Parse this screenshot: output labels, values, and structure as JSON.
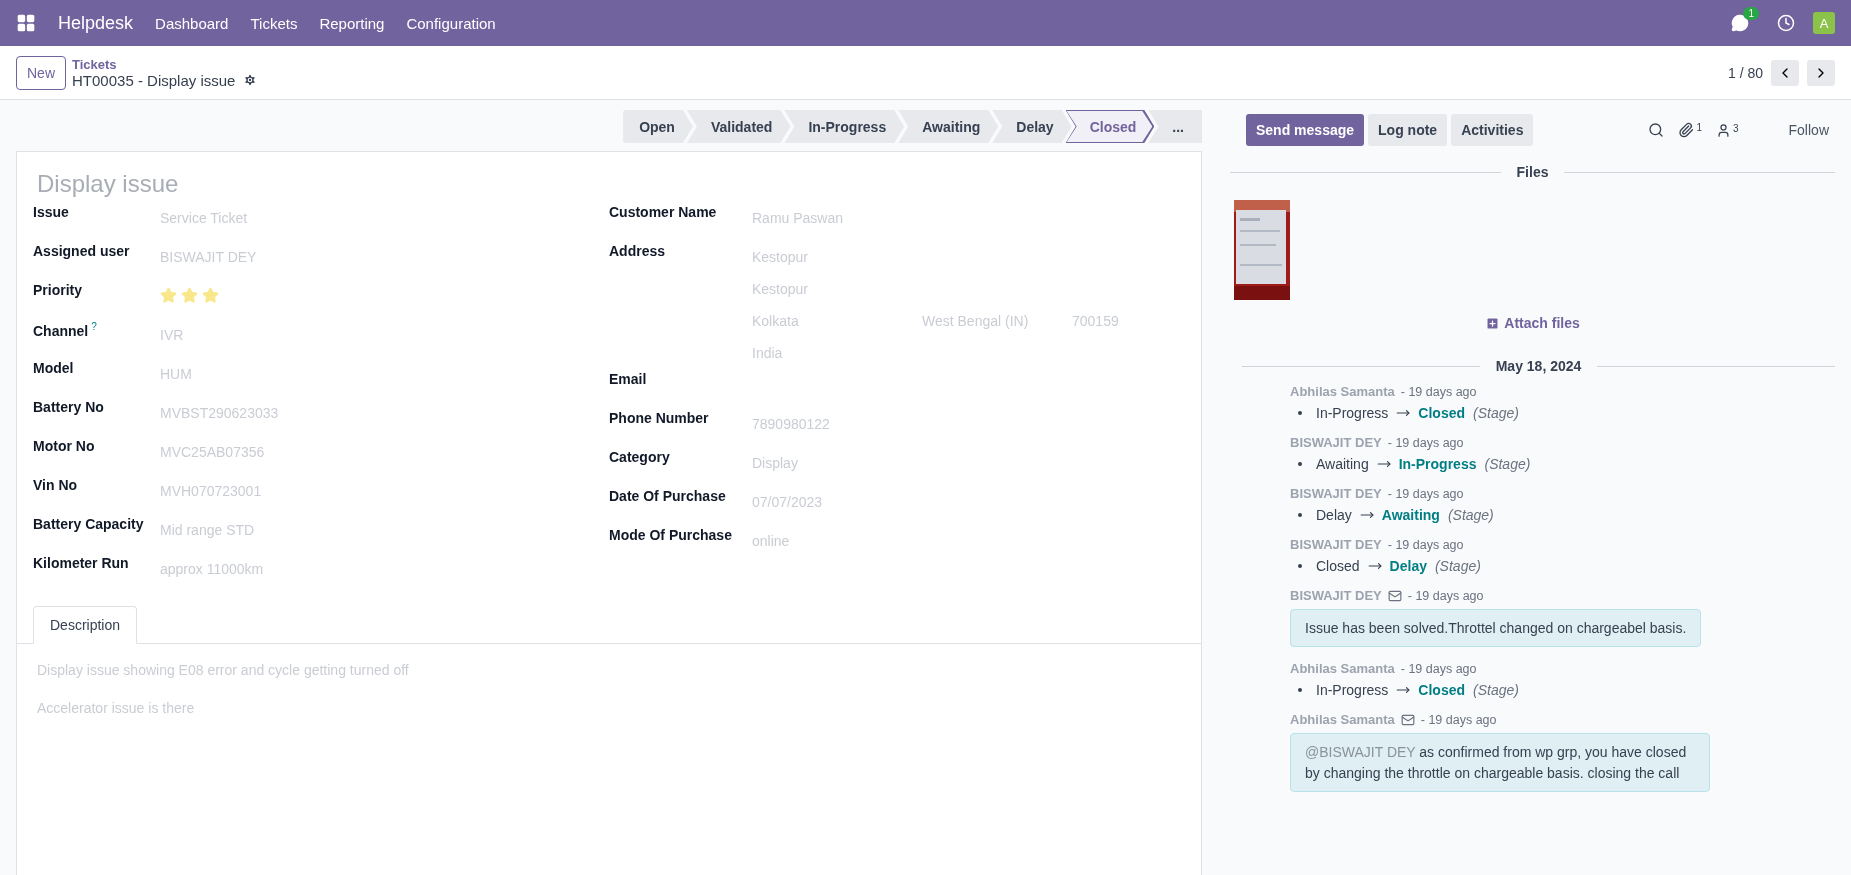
{
  "navbar": {
    "app": "Helpdesk",
    "menu": [
      "Dashboard",
      "Tickets",
      "Reporting",
      "Configuration"
    ],
    "messages_badge": "1",
    "avatar": "A"
  },
  "control_panel": {
    "new_button": "New",
    "breadcrumb": "Tickets",
    "record": "HT00035 - Display issue",
    "pager": "1 / 80"
  },
  "stages": [
    {
      "label": "Open",
      "selected": false
    },
    {
      "label": "Validated",
      "selected": false
    },
    {
      "label": "In-Progress",
      "selected": false
    },
    {
      "label": "Awaiting",
      "selected": false
    },
    {
      "label": "Delay",
      "selected": false
    },
    {
      "label": "Closed",
      "selected": true
    },
    {
      "label": "...",
      "selected": false
    }
  ],
  "form": {
    "title": "Display issue",
    "left_fields": [
      {
        "label": "Issue",
        "value": "Service Ticket"
      },
      {
        "label": "Assigned user",
        "value": "BISWAJIT DEY"
      },
      {
        "label": "Priority",
        "kind": "stars",
        "stars": 3
      },
      {
        "label": "Channel",
        "help": "?",
        "value": "IVR"
      },
      {
        "label": "Model",
        "value": "HUM"
      },
      {
        "label": "Battery No",
        "value": "MVBST290623033"
      },
      {
        "label": "Motor No",
        "value": "MVC25AB07356"
      },
      {
        "label": "Vin No",
        "value": "MVH070723001"
      },
      {
        "label": "Battery Capacity",
        "value": "Mid range STD"
      },
      {
        "label": "Kilometer Run",
        "value": "approx 11000km"
      }
    ],
    "right_fields": [
      {
        "label": "Customer Name",
        "value": "Ramu Paswan"
      },
      {
        "label": "Address",
        "kind": "address",
        "street": "Kestopur",
        "street2": "Kestopur",
        "city": "Kolkata",
        "state": "West Bengal (IN)",
        "zip": "700159",
        "country": "India"
      },
      {
        "label": "Email"
      },
      {
        "label": "Phone Number",
        "value": "7890980122"
      },
      {
        "label": "Category",
        "value": "Display"
      },
      {
        "label": "Date Of Purchase",
        "value": "07/07/2023"
      },
      {
        "label": "Mode Of Purchase",
        "value": "online"
      }
    ],
    "tabs": [
      {
        "label": "Description",
        "selected": true
      }
    ],
    "description": [
      "Display issue showing E08 error and cycle getting turned off",
      "Accelerator issue is there"
    ]
  },
  "chatter": {
    "buttons": [
      {
        "label": "Send message",
        "selected": true
      },
      {
        "label": "Log note",
        "selected": false
      },
      {
        "label": "Activities",
        "selected": false
      }
    ],
    "attachments_count": "1",
    "followers_count": "3",
    "follow": "Follow",
    "files_title": "Files",
    "attach": "Attach files",
    "date": "May 18, 2024",
    "messages": [
      {
        "kind": "tracking",
        "author": "Abhilas Samanta",
        "time": "- 19 days ago",
        "old": "In-Progress",
        "new": "Closed",
        "field": "(Stage)"
      },
      {
        "kind": "tracking",
        "author": "BISWAJIT DEY",
        "time": "- 19 days ago",
        "old": "Awaiting",
        "new": "In-Progress",
        "field": "(Stage)"
      },
      {
        "kind": "tracking",
        "author": "BISWAJIT DEY",
        "time": "- 19 days ago",
        "old": "Delay",
        "new": "Awaiting",
        "field": "(Stage)"
      },
      {
        "kind": "tracking",
        "author": "BISWAJIT DEY",
        "time": "- 19 days ago",
        "old": "Closed",
        "new": "Delay",
        "field": "(Stage)"
      },
      {
        "kind": "message",
        "author": "BISWAJIT DEY",
        "time": "- 19 days ago",
        "body": "Issue has been solved.Throttel changed on chargeabel basis."
      },
      {
        "kind": "tracking",
        "author": "Abhilas Samanta",
        "time": "- 19 days ago",
        "old": "In-Progress",
        "new": "Closed",
        "field": "(Stage)"
      },
      {
        "kind": "message",
        "author": "Abhilas Samanta",
        "time": "- 19 days ago",
        "mention": "@BISWAJIT DEY",
        "body": "as confirmed from wp grp, you have closed by changing the throttle on chargeable basis. closing the call"
      }
    ]
  }
}
